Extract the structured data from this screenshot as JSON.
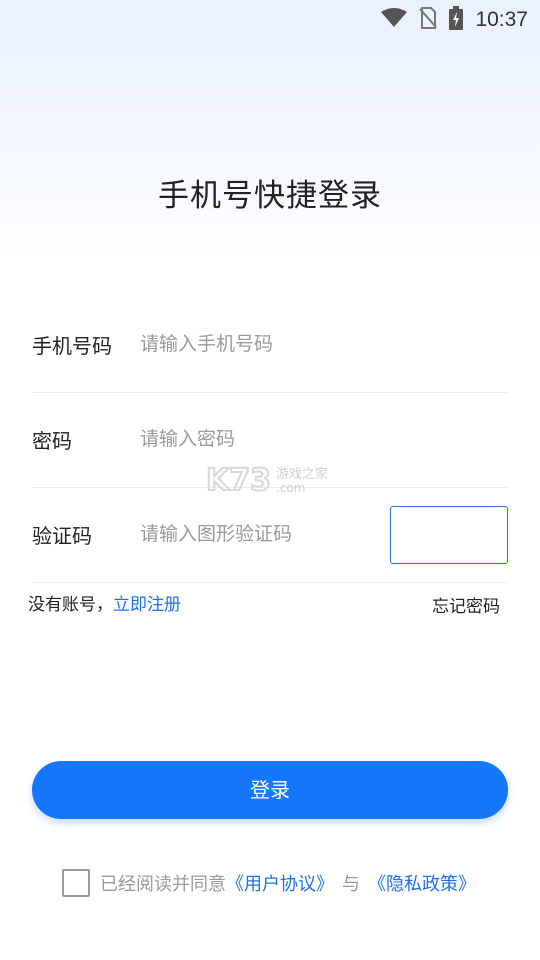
{
  "status_bar": {
    "time": "10:37",
    "icons": [
      "wifi-icon",
      "no-sim-icon",
      "battery-charging-icon"
    ]
  },
  "page": {
    "title": "手机号快捷登录"
  },
  "form": {
    "phone": {
      "label": "手机号码",
      "placeholder": "请输入手机号码",
      "value": ""
    },
    "password": {
      "label": "密码",
      "placeholder": "请输入密码",
      "value": ""
    },
    "captcha": {
      "label": "验证码",
      "placeholder": "请输入图形验证码",
      "value": ""
    }
  },
  "links": {
    "no_account": "没有账号，",
    "register": "立即注册",
    "forgot": "忘记密码"
  },
  "login_button": {
    "label": "登录"
  },
  "agreement": {
    "checked": false,
    "prefix": "已经阅读并同意",
    "user_agreement": "《用户协议》",
    "and": "与",
    "privacy_policy": "《隐私政策》"
  },
  "watermark": {
    "logo": "K73",
    "sub": "游戏之家",
    "domain": ".com"
  },
  "colors": {
    "accent": "#1677fb",
    "link": "#1f6fe8",
    "placeholder": "#9a9a9a"
  }
}
